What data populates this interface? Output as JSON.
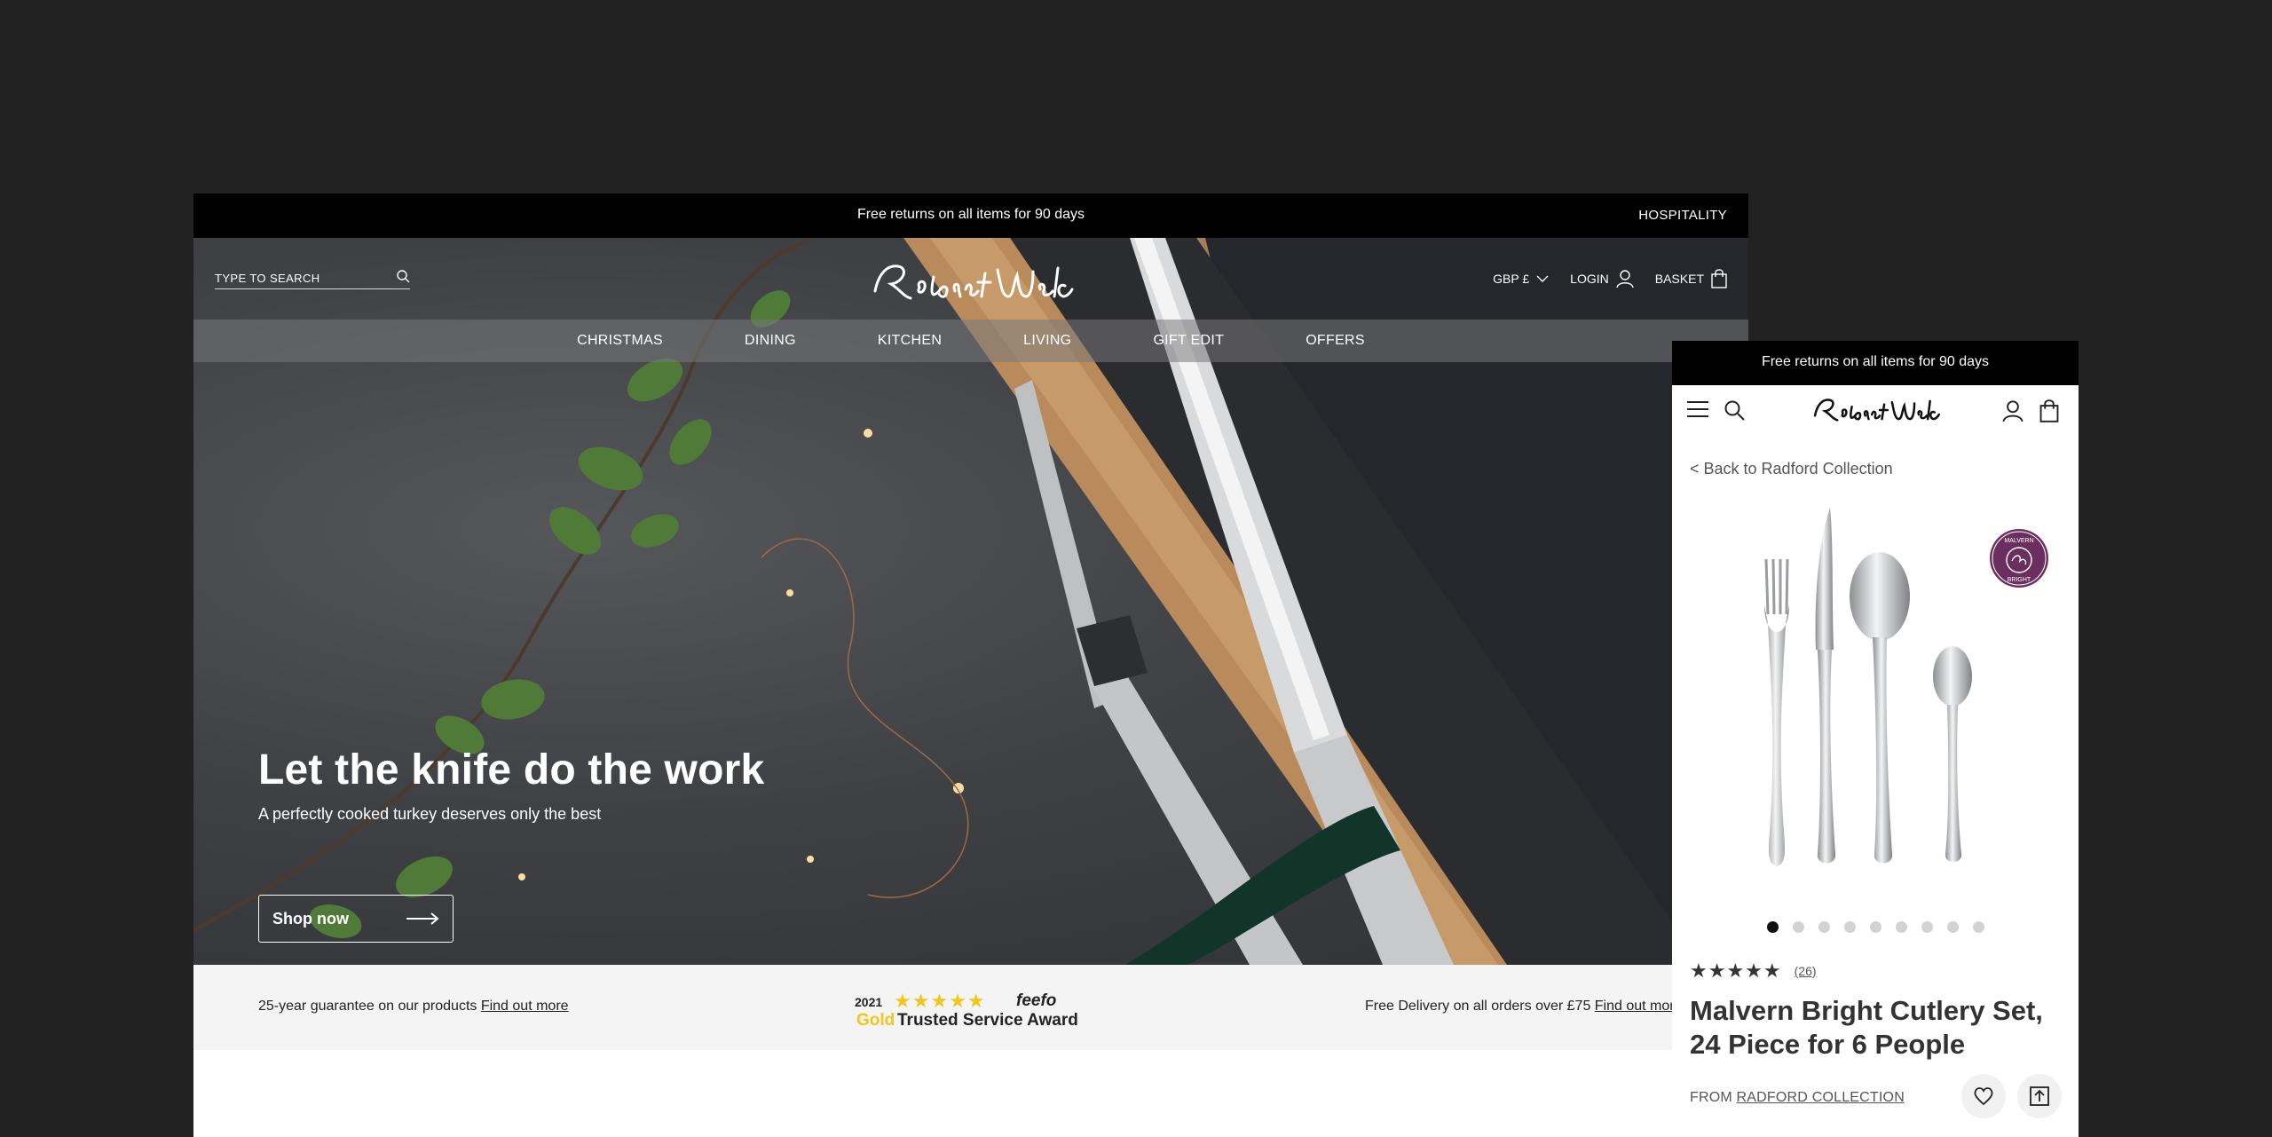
{
  "desktop": {
    "announcement": "Free returns on all items for 90 days",
    "hospitality_link": "HOSPITALITY",
    "search": {
      "placeholder": "TYPE TO SEARCH"
    },
    "logo_text": "Robert Welch",
    "header_links": {
      "currency": "GBP £",
      "login": "LOGIN",
      "basket": "BASKET"
    },
    "nav": [
      "CHRISTMAS",
      "DINING",
      "KITCHEN",
      "LIVING",
      "GIFT EDIT",
      "OFFERS"
    ],
    "hero": {
      "title": "Let the knife do the work",
      "subtitle": "A perfectly cooked turkey deserves only the best",
      "button": "Shop now"
    },
    "usp": {
      "left_text": "25-year guarantee on our products ",
      "left_link": "Find out more",
      "feefo_year": "2021",
      "feefo_brand": "feefo",
      "feefo_gold": "Gold",
      "feefo_award": "Trusted Service Award",
      "right_text": "Free Delivery on all orders over £75 ",
      "right_link": "Find out more"
    }
  },
  "mobile": {
    "announcement": "Free returns on all items for 90 days",
    "logo_text": "Robert Welch",
    "back_link": "< Back to Radford Collection",
    "badge_top": "MALVERN",
    "badge_bottom": "BRIGHT",
    "gallery_dots": 9,
    "active_dot": 1,
    "rating": {
      "stars": 5,
      "count": "(26)"
    },
    "product_title": "Malvern Bright Cutlery Set, 24 Piece for 6 People",
    "from_label": "FROM ",
    "collection_link": "RADFORD COLLECTION"
  },
  "colors": {
    "announcement_bg": "#000000",
    "badge": "#6b2f5f",
    "feefo_star": "#f2c61f",
    "page_bg": "#222222"
  },
  "icons": [
    "search-icon",
    "chevron-down-icon",
    "user-icon",
    "bag-icon",
    "arrow-right-icon",
    "menu-icon",
    "heart-icon",
    "share-icon",
    "star-icon"
  ]
}
